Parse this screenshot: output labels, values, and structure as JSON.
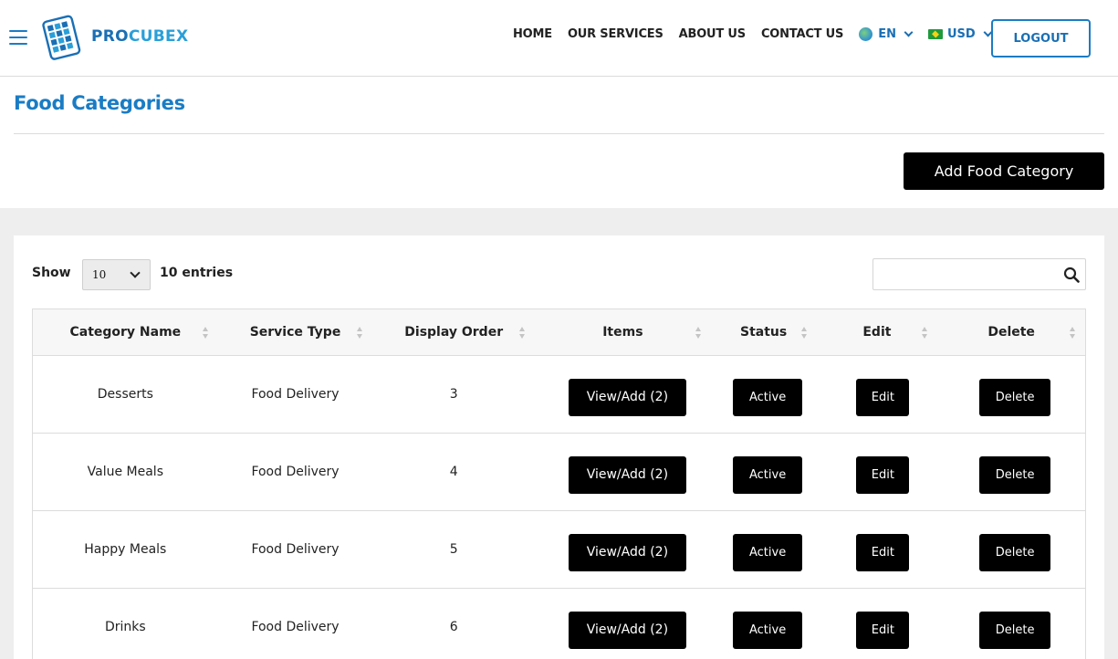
{
  "brand": {
    "name_part1": "PRO",
    "name_part2": "CUBEX"
  },
  "nav": {
    "links": [
      "HOME",
      "OUR SERVICES",
      "ABOUT US",
      "CONTACT US"
    ],
    "language": "EN",
    "currency": "USD",
    "logout_label": "LOGOUT"
  },
  "page": {
    "title": "Food Categories",
    "add_button": "Add Food Category"
  },
  "table_controls": {
    "show_label": "Show",
    "page_size": "10",
    "entries_label": "10 entries",
    "search_value": ""
  },
  "table": {
    "columns": [
      "Category Name",
      "Service Type",
      "Display Order",
      "Items",
      "Status",
      "Edit",
      "Delete"
    ],
    "rows": [
      {
        "name": "Desserts",
        "service": "Food Delivery",
        "order": "3",
        "items": "View/Add (2)",
        "status": "Active",
        "edit": "Edit",
        "delete": "Delete"
      },
      {
        "name": "Value Meals",
        "service": "Food Delivery",
        "order": "4",
        "items": "View/Add (2)",
        "status": "Active",
        "edit": "Edit",
        "delete": "Delete"
      },
      {
        "name": "Happy Meals",
        "service": "Food Delivery",
        "order": "5",
        "items": "View/Add (2)",
        "status": "Active",
        "edit": "Edit",
        "delete": "Delete"
      },
      {
        "name": "Drinks",
        "service": "Food Delivery",
        "order": "6",
        "items": "View/Add (2)",
        "status": "Active",
        "edit": "Edit",
        "delete": "Delete"
      }
    ]
  },
  "colors": {
    "brand_blue": "#1a7cc4",
    "button_black": "#000000",
    "band_grey": "#eeeeee"
  },
  "icons": [
    "hamburger-icon",
    "globe-icon",
    "brazil-flag-icon",
    "chevron-down-icon",
    "search-icon",
    "sort-icon"
  ]
}
